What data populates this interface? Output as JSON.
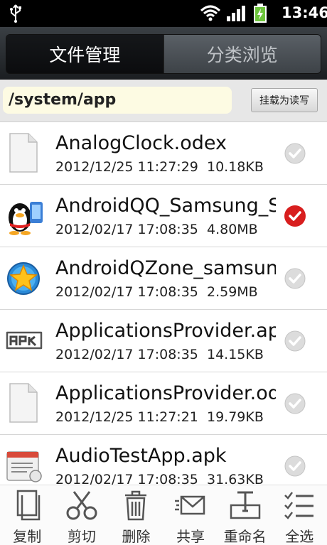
{
  "status_bar": {
    "time": "13:46"
  },
  "tabs": [
    {
      "label": "文件管理",
      "active": true
    },
    {
      "label": "分类浏览",
      "active": false
    }
  ],
  "path_bar": {
    "path": "/system/app",
    "mount_label": "挂载为读写"
  },
  "files": [
    {
      "name": "AnalogClock.odex",
      "date": "2012/12/25 11:27:29",
      "size": "10.18KB",
      "icon": "document-icon",
      "checked": false
    },
    {
      "name": "AndroidQQ_Samsung_Se",
      "date": "2012/02/17 17:08:35",
      "size": "4.80MB",
      "icon": "qq-penguin-icon",
      "checked": true
    },
    {
      "name": "AndroidQZone_samsung",
      "date": "2012/02/17 17:08:35",
      "size": "2.59MB",
      "icon": "qzone-star-icon",
      "checked": false
    },
    {
      "name": "ApplicationsProvider.apk",
      "date": "2012/02/17 17:08:35",
      "size": "14.15KB",
      "icon": "apk-icon",
      "checked": false
    },
    {
      "name": "ApplicationsProvider.ode",
      "date": "2012/12/25 11:27:21",
      "size": "19.79KB",
      "icon": "document-icon",
      "checked": false
    },
    {
      "name": "AudioTestApp.apk",
      "date": "2012/02/17 17:08:35",
      "size": "31.63KB",
      "icon": "audio-app-icon",
      "checked": false
    }
  ],
  "toolbar": {
    "copy": "复制",
    "cut": "剪切",
    "delete": "删除",
    "share": "共享",
    "rename": "重命名",
    "select_all": "全选"
  },
  "colors": {
    "checked": "#d81e1e",
    "unchecked": "#c8c8c8",
    "path_bg": "#fdfbe3",
    "tab_bar": "#2a2e32"
  }
}
